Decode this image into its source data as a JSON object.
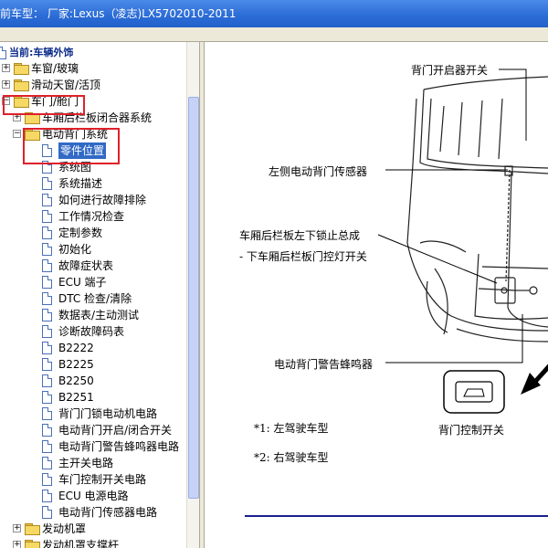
{
  "window": {
    "title": "前车型： 厂家:Lexus（凌志)LX5702010-2011"
  },
  "tree": {
    "current_label": "当前:车辆外饰",
    "items": [
      {
        "label": "车窗/玻璃",
        "type": "folder",
        "level": 0
      },
      {
        "label": "滑动天窗/活顶",
        "type": "folder",
        "level": 0
      },
      {
        "label": "车门/舱门",
        "type": "folder",
        "level": 0,
        "expanded": true,
        "highlighted": true
      },
      {
        "label": "车厢后栏板闭合器系统",
        "type": "folder",
        "level": 1
      },
      {
        "label": "电动背门系统",
        "type": "folder",
        "level": 1,
        "expanded": true,
        "highlighted": true
      },
      {
        "label": "零件位置",
        "type": "page",
        "level": 2,
        "selected": true,
        "highlighted": true
      },
      {
        "label": "系统图",
        "type": "page",
        "level": 2
      },
      {
        "label": "系统描述",
        "type": "page",
        "level": 2
      },
      {
        "label": "如何进行故障排除",
        "type": "page",
        "level": 2
      },
      {
        "label": "工作情况检查",
        "type": "page",
        "level": 2
      },
      {
        "label": "定制参数",
        "type": "page",
        "level": 2
      },
      {
        "label": "初始化",
        "type": "page",
        "level": 2
      },
      {
        "label": "故障症状表",
        "type": "page",
        "level": 2
      },
      {
        "label": "ECU 端子",
        "type": "page",
        "level": 2
      },
      {
        "label": "DTC 检查/清除",
        "type": "page",
        "level": 2
      },
      {
        "label": "数据表/主动测试",
        "type": "page",
        "level": 2
      },
      {
        "label": "诊断故障码表",
        "type": "page",
        "level": 2
      },
      {
        "label": "B2222",
        "type": "page",
        "level": 2
      },
      {
        "label": "B2225",
        "type": "page",
        "level": 2
      },
      {
        "label": "B2250",
        "type": "page",
        "level": 2
      },
      {
        "label": "B2251",
        "type": "page",
        "level": 2
      },
      {
        "label": "背门门锁电动机电路",
        "type": "page",
        "level": 2
      },
      {
        "label": "电动背门开启/闭合开关",
        "type": "page",
        "level": 2
      },
      {
        "label": "电动背门警告蜂鸣器电路",
        "type": "page",
        "level": 2
      },
      {
        "label": "主开关电路",
        "type": "page",
        "level": 2
      },
      {
        "label": "车门控制开关电路",
        "type": "page",
        "level": 2
      },
      {
        "label": "ECU 电源电路",
        "type": "page",
        "level": 2
      },
      {
        "label": "电动背门传感器电路",
        "type": "page",
        "level": 2
      },
      {
        "label": "发动机罩",
        "type": "folder",
        "level": 1
      },
      {
        "label": "发动机罩支撑杆",
        "type": "folder",
        "level": 1
      }
    ]
  },
  "diagram": {
    "labels": {
      "back_door_opener_switch": "背门开启器开关",
      "left_power_back_door_sensor": "左侧电动背门传感器",
      "tailgate_lower_lock_assembly_left": "车厢后栏板左下锁止总成",
      "lower_tailgate_courtesy_switch": "- 下车厢后栏板门控灯开关",
      "power_back_door_warning_buzzer": "电动背门警告蜂鸣器",
      "back_door_control_switch": "背门控制开关",
      "note_lhd": "*1: 左驾驶车型",
      "note_rhd": "*2: 右驾驶车型"
    },
    "colors": {
      "rule": "#1a1f8c",
      "highlight": "#e0202a",
      "selection": "#316ac5"
    }
  }
}
